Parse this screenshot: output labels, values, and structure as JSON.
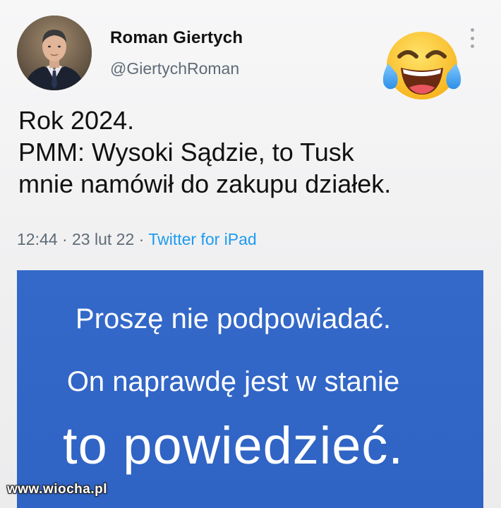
{
  "tweet": {
    "author_name": "Roman Giertych",
    "author_handle": "@GiertychRoman",
    "text_lines": [
      "Rok 2024.",
      "PMM: Wysoki Sądzie, to Tusk",
      "mnie namówił do zakupu działek."
    ],
    "time": "12:44",
    "date": "23 lut 22",
    "separator": "·",
    "source": "Twitter for iPad",
    "emoji": "face-with-tears-of-joy"
  },
  "meme": {
    "line1": "Proszę nie podpowiadać.",
    "line2": "On naprawdę jest w stanie",
    "line3": "to powiedzieć."
  },
  "watermark": "www.wiocha.pl",
  "colors": {
    "meme_background": "#3166c7",
    "link": "#1d9bf0",
    "handle_gray": "#5f6b76"
  }
}
